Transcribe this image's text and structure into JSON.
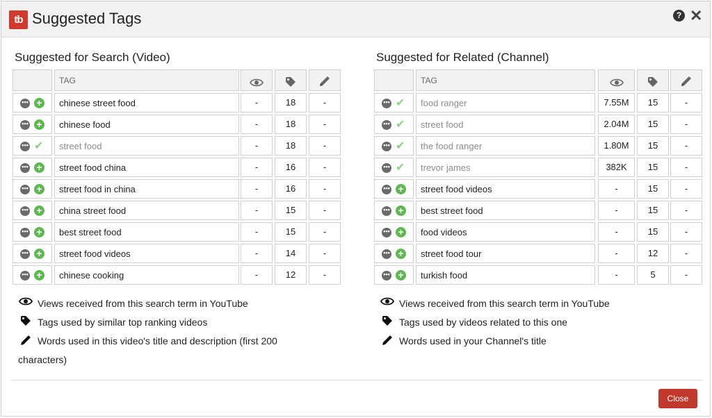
{
  "dialog": {
    "logo_text": "tb",
    "title": "Suggested Tags",
    "help_icon": "question-circle-icon",
    "close_icon": "close-icon",
    "close_button": "Close"
  },
  "search": {
    "title": "Suggested for Search (Video)",
    "header": {
      "tag": "TAG",
      "views_icon": "eye-icon",
      "tags_icon": "tag-icon",
      "words_icon": "pencil-icon"
    },
    "rows": [
      {
        "status": "add",
        "tag": "chinese street food",
        "views": "-",
        "count": "18",
        "words": "-"
      },
      {
        "status": "add",
        "tag": "chinese food",
        "views": "-",
        "count": "18",
        "words": "-"
      },
      {
        "status": "added",
        "tag": "street food",
        "views": "-",
        "count": "18",
        "words": "-"
      },
      {
        "status": "add",
        "tag": "street food china",
        "views": "-",
        "count": "16",
        "words": "-"
      },
      {
        "status": "add",
        "tag": "street food in china",
        "views": "-",
        "count": "16",
        "words": "-"
      },
      {
        "status": "add",
        "tag": "china street food",
        "views": "-",
        "count": "15",
        "words": "-"
      },
      {
        "status": "add",
        "tag": "best street food",
        "views": "-",
        "count": "15",
        "words": "-"
      },
      {
        "status": "add",
        "tag": "street food videos",
        "views": "-",
        "count": "14",
        "words": "-"
      },
      {
        "status": "add",
        "tag": "chinese cooking",
        "views": "-",
        "count": "12",
        "words": "-"
      }
    ],
    "legend": [
      {
        "icon": "eye-icon",
        "text": "Views received from this search term in YouTube"
      },
      {
        "icon": "tag-icon",
        "text": "Tags used by similar top ranking videos"
      },
      {
        "icon": "pencil-icon",
        "text": "Words used in this video's title and description (first 200",
        "text2": "characters)"
      }
    ]
  },
  "related": {
    "title": "Suggested for Related (Channel)",
    "header": {
      "tag": "TAG",
      "views_icon": "eye-icon",
      "tags_icon": "tag-icon",
      "words_icon": "pencil-icon"
    },
    "rows": [
      {
        "status": "added",
        "tag": "food ranger",
        "views": "7.55M",
        "count": "15",
        "words": "-"
      },
      {
        "status": "added",
        "tag": "street food",
        "views": "2.04M",
        "count": "15",
        "words": "-"
      },
      {
        "status": "added",
        "tag": "the food ranger",
        "views": "1.80M",
        "count": "15",
        "words": "-"
      },
      {
        "status": "added",
        "tag": "trevor james",
        "views": "382K",
        "count": "15",
        "words": "-"
      },
      {
        "status": "add",
        "tag": "street food videos",
        "views": "-",
        "count": "15",
        "words": "-"
      },
      {
        "status": "add",
        "tag": "best street food",
        "views": "-",
        "count": "15",
        "words": "-"
      },
      {
        "status": "add",
        "tag": "food videos",
        "views": "-",
        "count": "15",
        "words": "-"
      },
      {
        "status": "add",
        "tag": "street food tour",
        "views": "-",
        "count": "12",
        "words": "-"
      },
      {
        "status": "add",
        "tag": "turkish food",
        "views": "-",
        "count": "5",
        "words": "-"
      }
    ],
    "legend": [
      {
        "icon": "eye-icon",
        "text": "Views received from this search term in YouTube"
      },
      {
        "icon": "tag-icon",
        "text": "Tags used by videos related to this one"
      },
      {
        "icon": "pencil-icon",
        "text": "Words used in your Channel's title"
      }
    ]
  },
  "colors": {
    "brand": "#d13b2d",
    "add": "#5cb84f",
    "added": "#8fd17f",
    "close_button": "#c0392b"
  }
}
